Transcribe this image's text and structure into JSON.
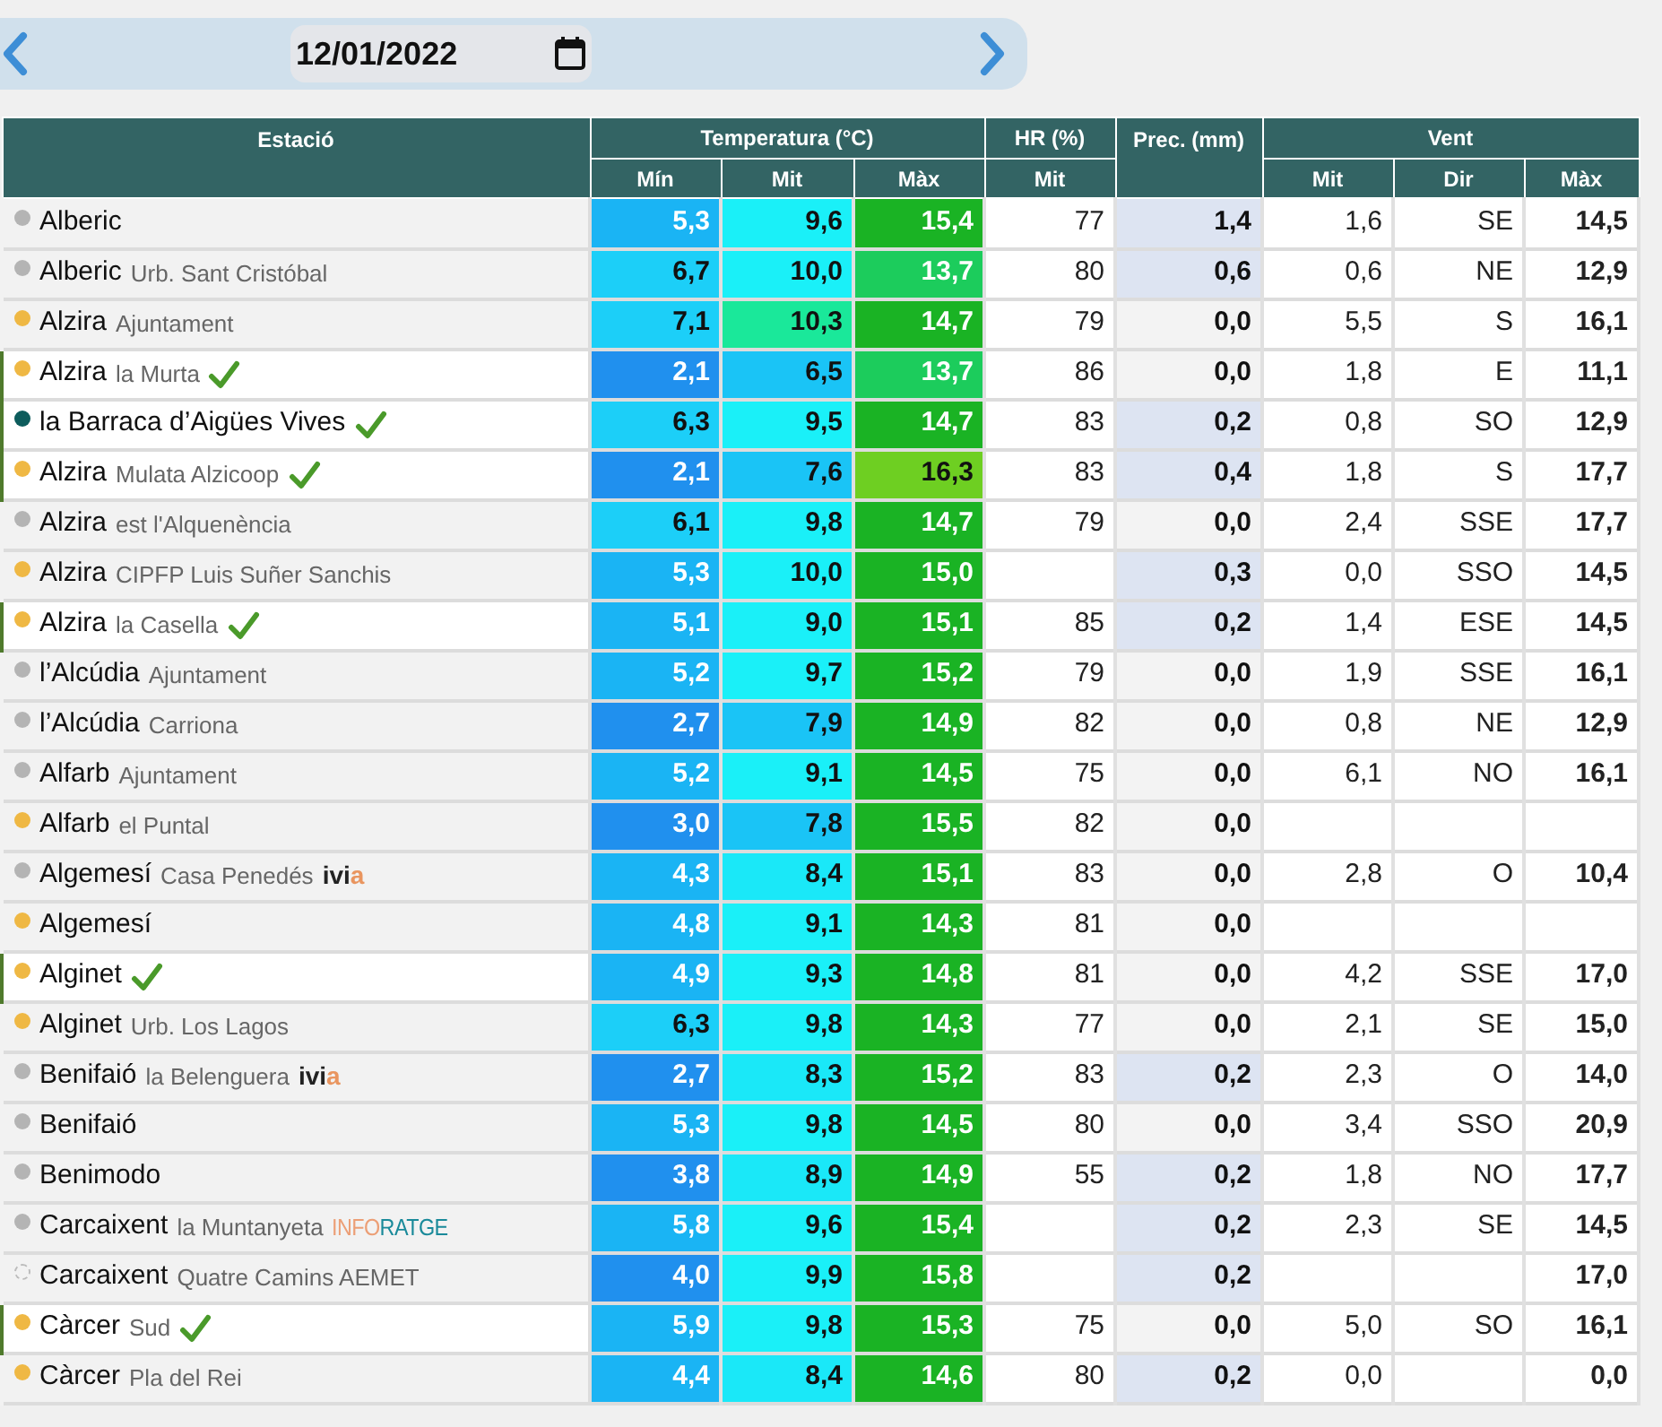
{
  "date_picker": {
    "value": "12/01/2022"
  },
  "header": {
    "groups": [
      {
        "label": "Estació"
      },
      {
        "label": "Temperatura (°C)",
        "sub": [
          "Mín",
          "Mit",
          "Màx"
        ]
      },
      {
        "label": "HR (%)",
        "sub": [
          "Mit"
        ]
      },
      {
        "label": "Prec. (mm)"
      },
      {
        "label": "Vent",
        "sub": [
          "Mit",
          "Dir",
          "Màx"
        ]
      }
    ]
  },
  "rows": [
    {
      "name": "Alberic",
      "dot": {
        "kind": "solid",
        "color": "#b4b4b4"
      },
      "verified": false,
      "min": {
        "value": "5,3",
        "color": "#1ab4f4"
      },
      "mit": {
        "value": "9,6",
        "color": "#1af0f8"
      },
      "max": {
        "value": "15,4",
        "color": "#1ab324"
      },
      "hr": "77",
      "prec": {
        "value": "1,4",
        "color": "#dde4f2"
      },
      "wind_mit": "1,6",
      "wind_dir": "SE",
      "wind_max": "14,5"
    },
    {
      "name": "Alberic",
      "sub": "Urb. Sant Cristóbal",
      "dot": {
        "kind": "solid",
        "color": "#b4b4b4"
      },
      "verified": false,
      "min": {
        "value": "6,7",
        "color": "#1ccff8"
      },
      "mit": {
        "value": "10,0",
        "color": "#1af0f8"
      },
      "max": {
        "value": "13,7",
        "color": "#1ccc5c"
      },
      "hr": "80",
      "prec": {
        "value": "0,6",
        "color": "#dde4f2"
      },
      "wind_mit": "0,6",
      "wind_dir": "NE",
      "wind_max": "12,9"
    },
    {
      "name": "Alzira",
      "sub": "Ajuntament",
      "dot": {
        "kind": "solid",
        "color": "#efb844"
      },
      "verified": false,
      "min": {
        "value": "7,1",
        "color": "#1ccff8"
      },
      "mit": {
        "value": "10,3",
        "color": "#1ae89a"
      },
      "max": {
        "value": "14,7",
        "color": "#1ab324"
      },
      "hr": "79",
      "prec": {
        "value": "0,0",
        "color": "#f3f3f3"
      },
      "wind_mit": "5,5",
      "wind_dir": "S",
      "wind_max": "16,1"
    },
    {
      "name": "Alzira",
      "sub": "la Murta",
      "dot": {
        "kind": "solid",
        "color": "#efb844"
      },
      "verified": true,
      "min": {
        "value": "2,1",
        "color": "#2090ee"
      },
      "mit": {
        "value": "6,5",
        "color": "#1ac4f6"
      },
      "max": {
        "value": "13,7",
        "color": "#1ccc5c"
      },
      "hr": "86",
      "prec": {
        "value": "0,0",
        "color": "#f3f3f3"
      },
      "wind_mit": "1,8",
      "wind_dir": "E",
      "wind_max": "11,1"
    },
    {
      "name": "la Barraca d’Aigües Vives",
      "dot": {
        "kind": "solid",
        "color": "#0d5c5c"
      },
      "verified": true,
      "min": {
        "value": "6,3",
        "color": "#1ccff8"
      },
      "mit": {
        "value": "9,5",
        "color": "#1af0f8"
      },
      "max": {
        "value": "14,7",
        "color": "#1ab324"
      },
      "hr": "83",
      "prec": {
        "value": "0,2",
        "color": "#dde4f2"
      },
      "wind_mit": "0,8",
      "wind_dir": "SO",
      "wind_max": "12,9"
    },
    {
      "name": "Alzira",
      "sub": "Mulata Alzicoop",
      "dot": {
        "kind": "solid",
        "color": "#efb844"
      },
      "verified": true,
      "min": {
        "value": "2,1",
        "color": "#2090ee"
      },
      "mit": {
        "value": "7,6",
        "color": "#1ac4f6"
      },
      "max": {
        "value": "16,3",
        "color": "#6ecf22"
      },
      "hr": "83",
      "prec": {
        "value": "0,4",
        "color": "#dde4f2"
      },
      "wind_mit": "1,8",
      "wind_dir": "S",
      "wind_max": "17,7"
    },
    {
      "name": "Alzira",
      "sub": "est l'Alquenència",
      "dot": {
        "kind": "solid",
        "color": "#b4b4b4"
      },
      "verified": false,
      "min": {
        "value": "6,1",
        "color": "#1ccff8"
      },
      "mit": {
        "value": "9,8",
        "color": "#1af0f8"
      },
      "max": {
        "value": "14,7",
        "color": "#1ab324"
      },
      "hr": "79",
      "prec": {
        "value": "0,0",
        "color": "#f3f3f3"
      },
      "wind_mit": "2,4",
      "wind_dir": "SSE",
      "wind_max": "17,7"
    },
    {
      "name": "Alzira",
      "sub": "CIPFP Luis Suñer Sanchis",
      "dot": {
        "kind": "solid",
        "color": "#efb844"
      },
      "verified": false,
      "min": {
        "value": "5,3",
        "color": "#1ab4f4"
      },
      "mit": {
        "value": "10,0",
        "color": "#1af0f8"
      },
      "max": {
        "value": "15,0",
        "color": "#1ab324"
      },
      "prec": {
        "value": "0,3",
        "color": "#dde4f2"
      },
      "wind_mit": "0,0",
      "wind_dir": "SSO",
      "wind_max": "14,5"
    },
    {
      "name": "Alzira",
      "sub": "la Casella",
      "dot": {
        "kind": "solid",
        "color": "#efb844"
      },
      "verified": true,
      "min": {
        "value": "5,1",
        "color": "#1ab4f4"
      },
      "mit": {
        "value": "9,0",
        "color": "#1af0f8"
      },
      "max": {
        "value": "15,1",
        "color": "#1ab324"
      },
      "hr": "85",
      "prec": {
        "value": "0,2",
        "color": "#dde4f2"
      },
      "wind_mit": "1,4",
      "wind_dir": "ESE",
      "wind_max": "14,5"
    },
    {
      "name": "l’Alcúdia",
      "sub": "Ajuntament",
      "dot": {
        "kind": "solid",
        "color": "#b4b4b4"
      },
      "verified": false,
      "min": {
        "value": "5,2",
        "color": "#1ab4f4"
      },
      "mit": {
        "value": "9,7",
        "color": "#1af0f8"
      },
      "max": {
        "value": "15,2",
        "color": "#1ab324"
      },
      "hr": "79",
      "prec": {
        "value": "0,0",
        "color": "#f3f3f3"
      },
      "wind_mit": "1,9",
      "wind_dir": "SSE",
      "wind_max": "16,1"
    },
    {
      "name": "l’Alcúdia",
      "sub": "Carriona",
      "dot": {
        "kind": "solid",
        "color": "#b4b4b4"
      },
      "verified": false,
      "min": {
        "value": "2,7",
        "color": "#2090ee"
      },
      "mit": {
        "value": "7,9",
        "color": "#1ac4f6"
      },
      "max": {
        "value": "14,9",
        "color": "#1ab324"
      },
      "hr": "82",
      "prec": {
        "value": "0,0",
        "color": "#f3f3f3"
      },
      "wind_mit": "0,8",
      "wind_dir": "NE",
      "wind_max": "12,9"
    },
    {
      "name": "Alfarb",
      "sub": "Ajuntament",
      "dot": {
        "kind": "solid",
        "color": "#b4b4b4"
      },
      "verified": false,
      "min": {
        "value": "5,2",
        "color": "#1ab4f4"
      },
      "mit": {
        "value": "9,1",
        "color": "#1af0f8"
      },
      "max": {
        "value": "14,5",
        "color": "#1ab324"
      },
      "hr": "75",
      "prec": {
        "value": "0,0",
        "color": "#f3f3f3"
      },
      "wind_mit": "6,1",
      "wind_dir": "NO",
      "wind_max": "16,1"
    },
    {
      "name": "Alfarb",
      "sub": "el Puntal",
      "dot": {
        "kind": "solid",
        "color": "#efb844"
      },
      "verified": false,
      "min": {
        "value": "3,0",
        "color": "#2090ee"
      },
      "mit": {
        "value": "7,8",
        "color": "#1ac4f6"
      },
      "max": {
        "value": "15,5",
        "color": "#1ab324"
      },
      "hr": "82",
      "prec": {
        "value": "0,0",
        "color": "#f3f3f3"
      }
    },
    {
      "name": "Algemesí",
      "sub": "Casa Penedés",
      "logo": {
        "kind": "ivia",
        "parts": [
          "ivi",
          "a"
        ]
      },
      "dot": {
        "kind": "solid",
        "color": "#b4b4b4"
      },
      "verified": false,
      "min": {
        "value": "4,3",
        "color": "#1ab4f4"
      },
      "mit": {
        "value": "8,4",
        "color": "#1ae8f8"
      },
      "max": {
        "value": "15,1",
        "color": "#1ab324"
      },
      "hr": "83",
      "prec": {
        "value": "0,0",
        "color": "#f3f3f3"
      },
      "wind_mit": "2,8",
      "wind_dir": "O",
      "wind_max": "10,4"
    },
    {
      "name": "Algemesí",
      "dot": {
        "kind": "solid",
        "color": "#efb844"
      },
      "verified": false,
      "min": {
        "value": "4,8",
        "color": "#1ab4f4"
      },
      "mit": {
        "value": "9,1",
        "color": "#1af0f8"
      },
      "max": {
        "value": "14,3",
        "color": "#1ab324"
      },
      "hr": "81",
      "prec": {
        "value": "0,0",
        "color": "#f3f3f3"
      }
    },
    {
      "name": "Alginet",
      "dot": {
        "kind": "solid",
        "color": "#efb844"
      },
      "verified": true,
      "min": {
        "value": "4,9",
        "color": "#1ab4f4"
      },
      "mit": {
        "value": "9,3",
        "color": "#1af0f8"
      },
      "max": {
        "value": "14,8",
        "color": "#1ab324"
      },
      "hr": "81",
      "prec": {
        "value": "0,0",
        "color": "#f3f3f3"
      },
      "wind_mit": "4,2",
      "wind_dir": "SSE",
      "wind_max": "17,0"
    },
    {
      "name": "Alginet",
      "sub": "Urb. Los Lagos",
      "dot": {
        "kind": "solid",
        "color": "#efb844"
      },
      "verified": false,
      "min": {
        "value": "6,3",
        "color": "#1ccff8"
      },
      "mit": {
        "value": "9,8",
        "color": "#1af0f8"
      },
      "max": {
        "value": "14,3",
        "color": "#1ab324"
      },
      "hr": "77",
      "prec": {
        "value": "0,0",
        "color": "#f3f3f3"
      },
      "wind_mit": "2,1",
      "wind_dir": "SE",
      "wind_max": "15,0"
    },
    {
      "name": "Benifaió",
      "sub": "la Belenguera",
      "logo": {
        "kind": "ivia",
        "parts": [
          "ivi",
          "a"
        ]
      },
      "dot": {
        "kind": "solid",
        "color": "#b4b4b4"
      },
      "verified": false,
      "min": {
        "value": "2,7",
        "color": "#2090ee"
      },
      "mit": {
        "value": "8,3",
        "color": "#1ae8f8"
      },
      "max": {
        "value": "15,2",
        "color": "#1ab324"
      },
      "hr": "83",
      "prec": {
        "value": "0,2",
        "color": "#dde4f2"
      },
      "wind_mit": "2,3",
      "wind_dir": "O",
      "wind_max": "14,0"
    },
    {
      "name": "Benifaió",
      "dot": {
        "kind": "solid",
        "color": "#b4b4b4"
      },
      "verified": false,
      "min": {
        "value": "5,3",
        "color": "#1ab4f4"
      },
      "mit": {
        "value": "9,8",
        "color": "#1af0f8"
      },
      "max": {
        "value": "14,5",
        "color": "#1ab324"
      },
      "hr": "80",
      "prec": {
        "value": "0,0",
        "color": "#f3f3f3"
      },
      "wind_mit": "3,4",
      "wind_dir": "SSO",
      "wind_max": "20,9"
    },
    {
      "name": "Benimodo",
      "dot": {
        "kind": "solid",
        "color": "#b4b4b4"
      },
      "verified": false,
      "min": {
        "value": "3,8",
        "color": "#2090ee"
      },
      "mit": {
        "value": "8,9",
        "color": "#1ae8f8"
      },
      "max": {
        "value": "14,9",
        "color": "#1ab324"
      },
      "hr": "55",
      "prec": {
        "value": "0,2",
        "color": "#dde4f2"
      },
      "wind_mit": "1,8",
      "wind_dir": "NO",
      "wind_max": "17,7"
    },
    {
      "name": "Carcaixent",
      "sub": "la Muntanyeta",
      "logo": {
        "kind": "inforatge",
        "parts": [
          "INFO",
          "RATGE"
        ]
      },
      "dot": {
        "kind": "solid",
        "color": "#b4b4b4"
      },
      "verified": false,
      "min": {
        "value": "5,8",
        "color": "#1ab4f4"
      },
      "mit": {
        "value": "9,6",
        "color": "#1af0f8"
      },
      "max": {
        "value": "15,4",
        "color": "#1ab324"
      },
      "prec": {
        "value": "0,2",
        "color": "#dde4f2"
      },
      "wind_mit": "2,3",
      "wind_dir": "SE",
      "wind_max": "14,5"
    },
    {
      "name": "Carcaixent",
      "sub": "Quatre Camins AEMET",
      "dot": {
        "kind": "dashed"
      },
      "verified": false,
      "min": {
        "value": "4,0",
        "color": "#2090ee"
      },
      "mit": {
        "value": "9,9",
        "color": "#1af0f8"
      },
      "max": {
        "value": "15,8",
        "color": "#1ab324"
      },
      "prec": {
        "value": "0,2",
        "color": "#dde4f2"
      },
      "wind_max": "17,0"
    },
    {
      "name": "Càrcer",
      "sub": "Sud",
      "dot": {
        "kind": "solid",
        "color": "#efb844"
      },
      "verified": true,
      "min": {
        "value": "5,9",
        "color": "#1ab4f4"
      },
      "mit": {
        "value": "9,8",
        "color": "#1af0f8"
      },
      "max": {
        "value": "15,3",
        "color": "#1ab324"
      },
      "hr": "75",
      "prec": {
        "value": "0,0",
        "color": "#f3f3f3"
      },
      "wind_mit": "5,0",
      "wind_dir": "SO",
      "wind_max": "16,1"
    },
    {
      "name": "Càrcer",
      "sub": "Pla del Rei",
      "dot": {
        "kind": "solid",
        "color": "#efb844"
      },
      "verified": false,
      "min": {
        "value": "4,4",
        "color": "#1ab4f4"
      },
      "mit": {
        "value": "8,4",
        "color": "#1ae8f8"
      },
      "max": {
        "value": "14,6",
        "color": "#1ab324"
      },
      "hr": "80",
      "prec": {
        "value": "0,2",
        "color": "#dde4f2"
      },
      "wind_mit": "0,0",
      "wind_max": "0,0"
    }
  ]
}
